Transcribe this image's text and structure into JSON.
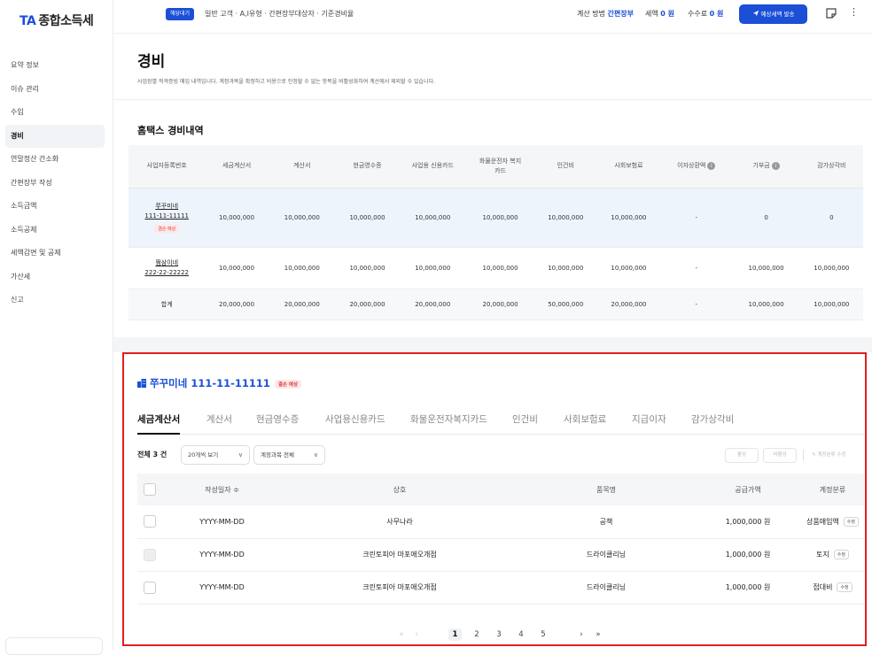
{
  "app": {
    "logo_mark": "TA",
    "logo_text": "종합소득세"
  },
  "sidebar": {
    "items": [
      "요약 정보",
      "이슈 관리",
      "수입",
      "경비",
      "연말정산 간소화",
      "간편장부 작성",
      "소득금액",
      "소득공제",
      "세액감면 및 공제",
      "가산세",
      "신고"
    ],
    "active_index": 3
  },
  "topbar": {
    "status_badge": "해당대기",
    "info": "일반 고객 · A,I유형 · 간편장부대상자 · 기준경비율",
    "method_label": "계산 방법",
    "method_value": "간편장부",
    "tax_label": "세액",
    "tax_value": "0 원",
    "fee_label": "수수료",
    "fee_value": "0 원",
    "estimate_button": "예상세액 발송"
  },
  "page": {
    "title": "경비",
    "subtitle": "사업장별 적격증빙 매입 내역입니다. 계정과목을 확정하고 비용으로 인정할 수 없는 항목을 비활성화하여 계산에서 제외할 수 있습니다."
  },
  "hometax": {
    "title": "홈택스 경비내역",
    "headers": [
      "사업자등록번호",
      "세금계산서",
      "계산서",
      "현금영수증",
      "사업용 신용카드",
      "화물운전자 복지카드",
      "인건비",
      "사회보험료",
      "이자상환액",
      "기부금",
      "감가상각비"
    ],
    "rows": [
      {
        "name": "쭈꾸미네",
        "bizno": "111-11-11111",
        "tag": "결손 예상",
        "values": [
          "10,000,000",
          "10,000,000",
          "10,000,000",
          "10,000,000",
          "10,000,000",
          "10,000,000",
          "10,000,000",
          "-",
          "0",
          "0"
        ]
      },
      {
        "name": "쩜삼이네",
        "bizno": "222-22-22222",
        "values": [
          "10,000,000",
          "10,000,000",
          "10,000,000",
          "10,000,000",
          "10,000,000",
          "10,000,000",
          "10,000,000",
          "-",
          "10,000,000",
          "10,000,000"
        ]
      },
      {
        "name": "합계",
        "values": [
          "20,000,000",
          "20,000,000",
          "20,000,000",
          "20,000,000",
          "20,000,000",
          "50,000,000",
          "20,000,000",
          "-",
          "10,000,000",
          "10,000,000"
        ]
      }
    ]
  },
  "detail": {
    "business": "쭈꾸미네 111-11-11111",
    "tag": "결손 예상",
    "tabs": [
      "세금계산서",
      "계산서",
      "현금영수증",
      "사업용신용카드",
      "화물운전자복지카드",
      "인건비",
      "사회보험료",
      "지급이자",
      "감가상각비"
    ],
    "active_tab": 0,
    "count": "전체 3 건",
    "view_select": "20개씩 보기",
    "account_select": "계정과목 전체",
    "activate": "활성",
    "deactivate": "비활성",
    "account_change": "계정분류 수정",
    "columns": [
      "작성일자 ≑",
      "상호",
      "품목명",
      "공급가액",
      "계정분류"
    ],
    "rows": [
      {
        "date": "YYYY-MM-DD",
        "shop": "사무나라",
        "item": "공책",
        "amount": "1,000,000 원",
        "account": "상품매입액",
        "edit": "수정"
      },
      {
        "date": "YYYY-MM-DD",
        "shop": "크린토피아 마포애오개점",
        "item": "드라이클리닝",
        "amount": "1,000,000 원",
        "account": "토지",
        "edit": "수정"
      },
      {
        "date": "YYYY-MM-DD",
        "shop": "크린토피아 마포애오개점",
        "item": "드라이클리닝",
        "amount": "1,000,000 원",
        "account": "접대비",
        "edit": "수정"
      }
    ],
    "pages": [
      "1",
      "2",
      "3",
      "4",
      "5"
    ]
  }
}
